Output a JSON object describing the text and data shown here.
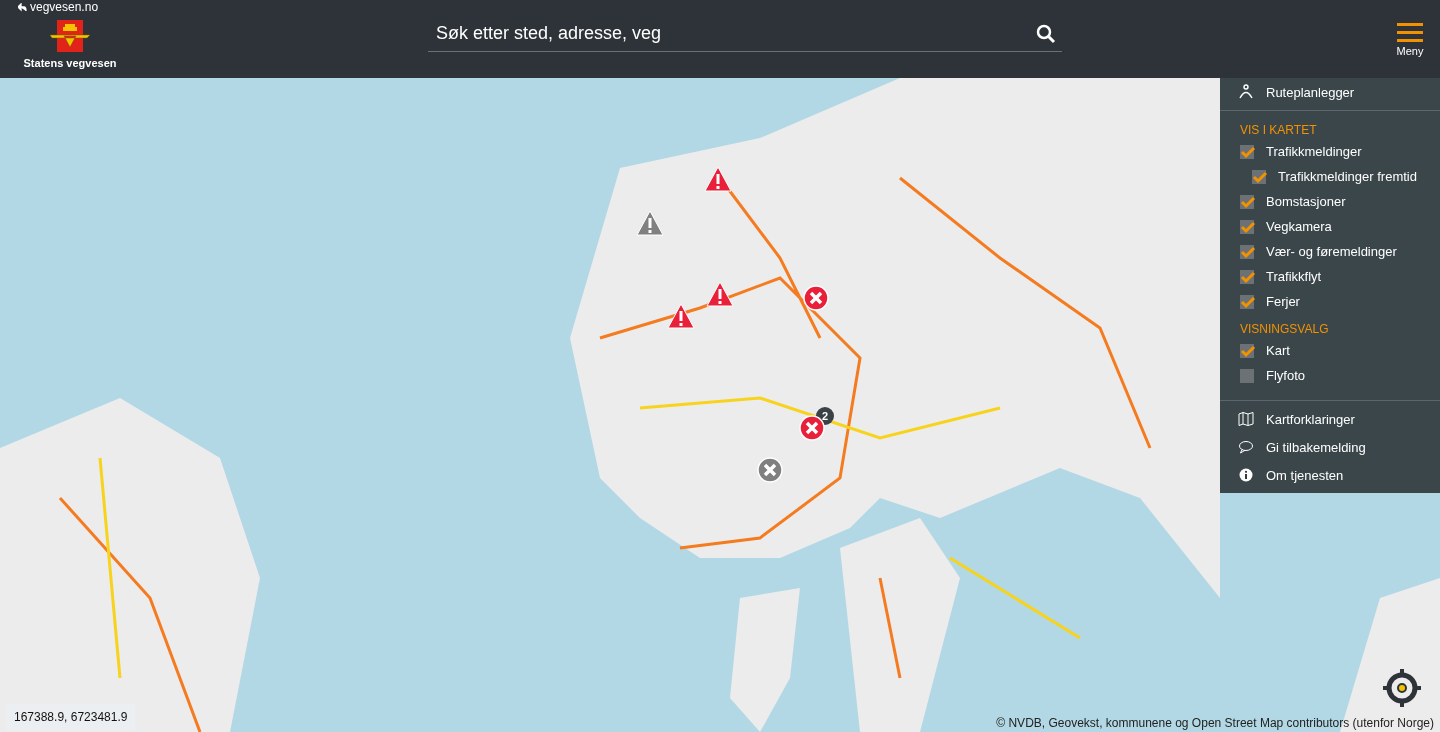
{
  "header": {
    "back_link": "vegvesen.no",
    "logo_text": "Statens vegvesen",
    "search": {
      "placeholder": "Søk etter sted, adresse, veg"
    },
    "menu_label": "Meny"
  },
  "map": {
    "markers": [
      {
        "kind": "warning",
        "color": "#e8203a"
      },
      {
        "kind": "warning",
        "color": "#808080"
      },
      {
        "kind": "warning",
        "color": "#e8203a"
      },
      {
        "kind": "warning",
        "color": "#e8203a"
      },
      {
        "kind": "closed",
        "color": "#e8203a"
      },
      {
        "kind": "cluster",
        "color": "#3a4147",
        "count": "2"
      },
      {
        "kind": "closed",
        "color": "#e8203a"
      },
      {
        "kind": "closed",
        "color": "#808080"
      }
    ],
    "coordinates": "167388.9, 6723481.9",
    "attribution": "© NVDB, Geovekst, kommunene og Open Street Map contributors (utenfor Norge)"
  },
  "menu": {
    "route_planner": "Ruteplanlegger",
    "sections": [
      {
        "title": "VIS I KARTET",
        "items": [
          {
            "label": "Trafikkmeldinger",
            "checked": true,
            "children": [
              {
                "label": "Trafikkmeldinger fremtid",
                "checked": true
              }
            ]
          },
          {
            "label": "Bomstasjoner",
            "checked": true
          },
          {
            "label": "Vegkamera",
            "checked": true
          },
          {
            "label": "Vær- og føremeldinger",
            "checked": true
          },
          {
            "label": "Trafikkflyt",
            "checked": true
          },
          {
            "label": "Ferjer",
            "checked": true
          }
        ]
      },
      {
        "title": "VISNINGSVALG",
        "items": [
          {
            "label": "Kart",
            "checked": true
          },
          {
            "label": "Flyfoto",
            "checked": false
          }
        ]
      }
    ],
    "links": [
      {
        "kind": "map",
        "label": "Kartforklaringer"
      },
      {
        "kind": "feedback",
        "label": "Gi tilbakemelding"
      },
      {
        "kind": "info",
        "label": "Om tjenesten"
      }
    ]
  }
}
